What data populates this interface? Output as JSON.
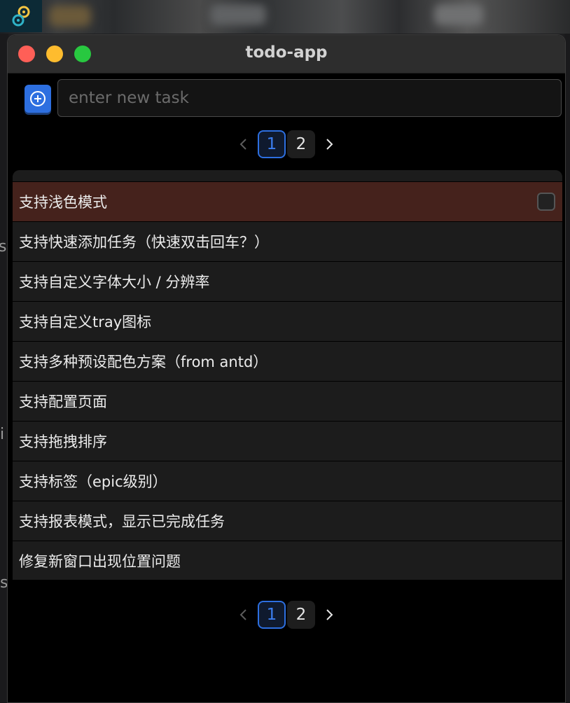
{
  "window": {
    "title": "todo-app"
  },
  "add_task": {
    "placeholder": "enter new task",
    "value": ""
  },
  "pagination": {
    "pages": [
      "1",
      "2"
    ],
    "current": "1"
  },
  "tasks": [
    {
      "label": "支持浅色模式",
      "highlighted": true,
      "checked": false
    },
    {
      "label": "支持快速添加任务（快速双击回车？）",
      "highlighted": false
    },
    {
      "label": "支持自定义字体大小 / 分辨率",
      "highlighted": false
    },
    {
      "label": "支持自定义tray图标",
      "highlighted": false
    },
    {
      "label": "支持多种预设配色方案（from antd）",
      "highlighted": false
    },
    {
      "label": "支持配置页面",
      "highlighted": false
    },
    {
      "label": "支持拖拽排序",
      "highlighted": false
    },
    {
      "label": "支持标签（epic级别）",
      "highlighted": false
    },
    {
      "label": "支持报表模式，显示已完成任务",
      "highlighted": false
    },
    {
      "label": "修复新窗口出现位置问题",
      "highlighted": false
    }
  ],
  "background_fragments": [
    "si",
    "i",
    "s"
  ],
  "colors": {
    "accent": "#2d6fe0",
    "highlight_row": "#45221c",
    "window_bg": "#000000",
    "row_bg": "#1c1c1c"
  },
  "icons": {
    "add": "plus-circle-icon",
    "prev": "chevron-left-icon",
    "next": "chevron-right-icon",
    "app": "tauri-logo-icon"
  }
}
